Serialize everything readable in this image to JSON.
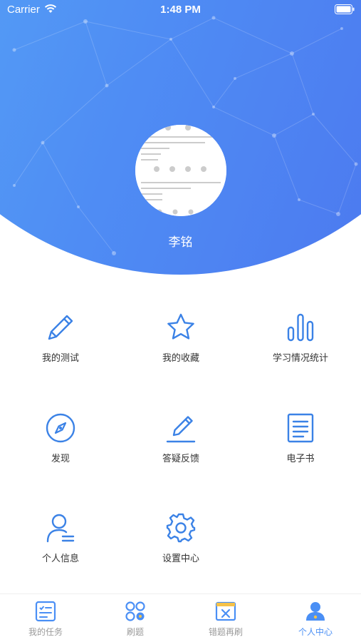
{
  "status_bar": {
    "carrier": "Carrier",
    "time": "1:48 PM"
  },
  "profile": {
    "name": "李铭"
  },
  "menu": {
    "items": [
      {
        "label": "我的测试",
        "icon": "pencil-icon"
      },
      {
        "label": "我的收藏",
        "icon": "star-icon"
      },
      {
        "label": "学习情况统计",
        "icon": "bar-chart-icon"
      },
      {
        "label": "发现",
        "icon": "compass-icon"
      },
      {
        "label": "答疑反馈",
        "icon": "edit-line-icon"
      },
      {
        "label": "电子书",
        "icon": "document-icon"
      },
      {
        "label": "个人信息",
        "icon": "user-icon"
      },
      {
        "label": "设置中心",
        "icon": "gear-icon"
      }
    ]
  },
  "tabbar": {
    "items": [
      {
        "label": "我的任务",
        "icon": "task-list-icon",
        "active": false
      },
      {
        "label": "刷题",
        "icon": "grid-dots-icon",
        "active": false
      },
      {
        "label": "错题再刷",
        "icon": "wrong-questions-icon",
        "active": false
      },
      {
        "label": "个人中心",
        "icon": "person-center-icon",
        "active": true
      }
    ]
  },
  "colors": {
    "accent": "#4a8ff5",
    "header_gradient_start": "#5aaef7",
    "header_gradient_end": "#4b72ee",
    "icon_blue": "#3b82e6",
    "text": "#333333",
    "tab_inactive": "#9a9a9a"
  }
}
